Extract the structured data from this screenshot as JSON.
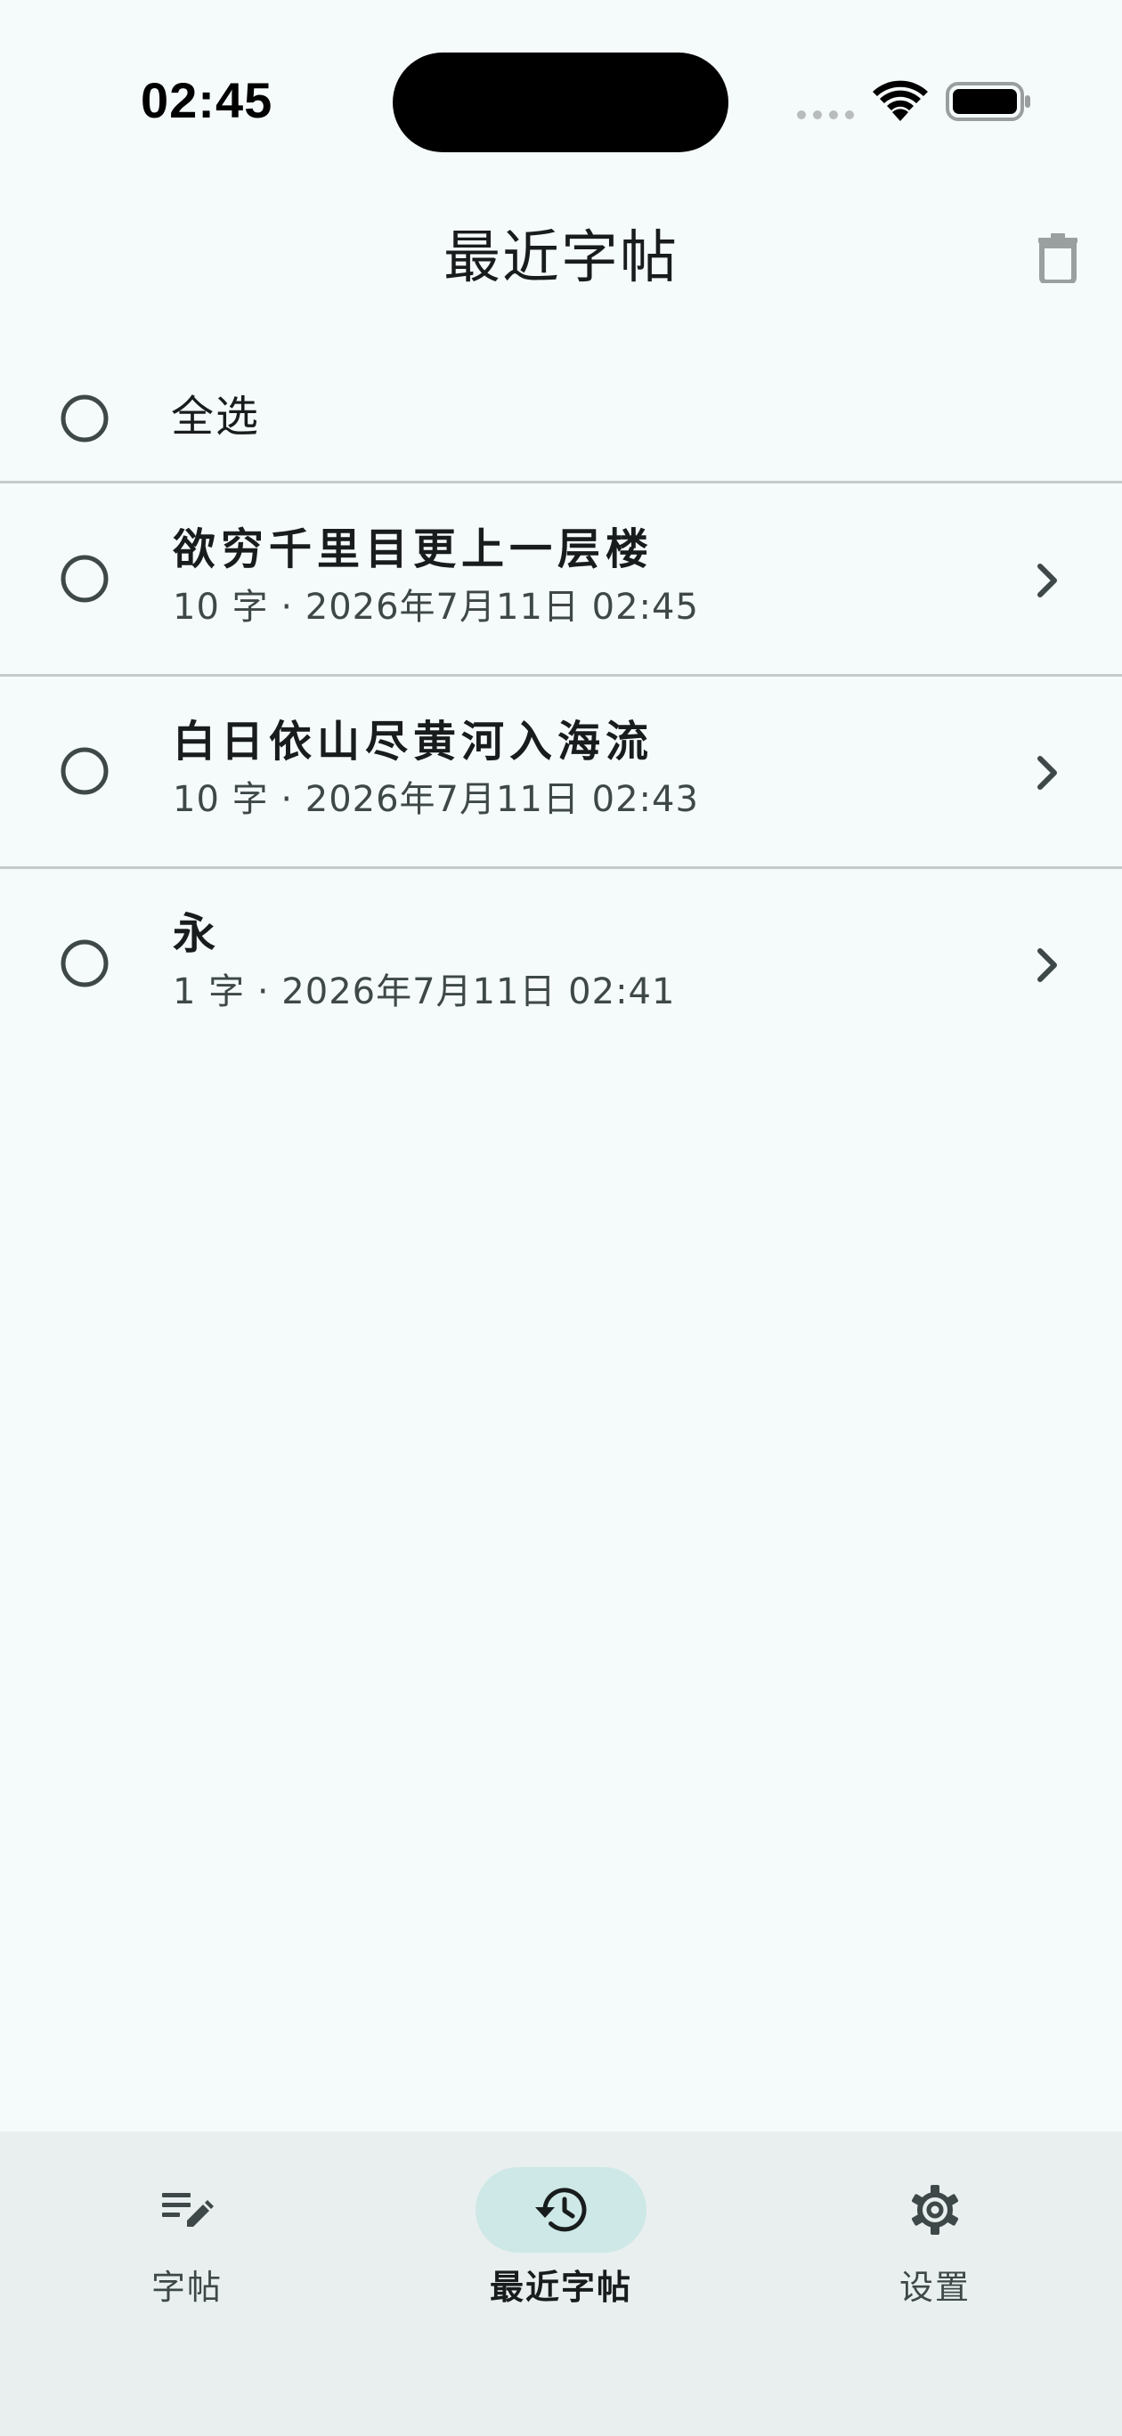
{
  "status_bar": {
    "time": "02:45"
  },
  "app_bar": {
    "title": "最近字帖",
    "delete_icon": "trash-icon"
  },
  "select_all": {
    "label": "全选",
    "checked": false
  },
  "items": [
    {
      "title": "欲穷千里目更上一层楼",
      "subtitle": "10 字 · 2026年7月11日 02:45",
      "checked": false
    },
    {
      "title": "白日依山尽黄河入海流",
      "subtitle": "10 字 · 2026年7月11日 02:43",
      "checked": false
    },
    {
      "title": "永",
      "subtitle": "1 字 · 2026年7月11日 02:41",
      "checked": false
    }
  ],
  "bottom_nav": {
    "items": [
      {
        "label": "字帖",
        "icon": "edit-note-icon",
        "active": false
      },
      {
        "label": "最近字帖",
        "icon": "history-icon",
        "active": true
      },
      {
        "label": "设置",
        "icon": "gear-icon",
        "active": false
      }
    ]
  },
  "colors": {
    "background": "#F5FAFA",
    "nav_background": "#E9EFEF",
    "nav_indicator": "#CDE8E6",
    "divider": "#C4CACA",
    "text_primary": "#191C1C",
    "text_secondary": "#3F4848"
  }
}
